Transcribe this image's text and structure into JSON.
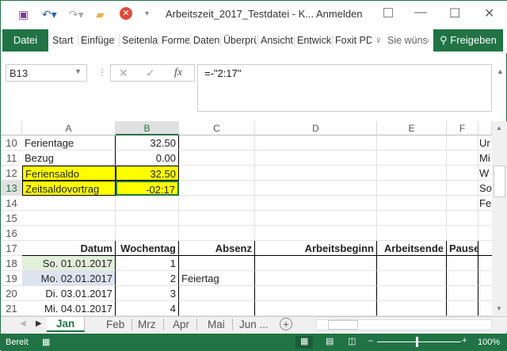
{
  "titlebar": {
    "title": "Arbeitszeit_2017_Testdatei - K...",
    "sign_in": "Anmelden",
    "icons": [
      "save-icon",
      "undo-icon",
      "redo-icon",
      "open-icon",
      "close-red-icon"
    ]
  },
  "ribbon": {
    "file": "Datei",
    "tabs": [
      "Start",
      "Einfüge",
      "Seitenla",
      "Formeln",
      "Daten",
      "Überprü",
      "Ansicht",
      "Entwick",
      "Foxit PD"
    ],
    "tell_me": "Sie wünsc",
    "share": "Freigeben"
  },
  "formula_bar": {
    "name_box": "B13",
    "formula": "=-\"2:17\""
  },
  "columns": [
    "A",
    "B",
    "C",
    "D",
    "E",
    "F"
  ],
  "rows": [
    {
      "n": "10",
      "a": "Ferientage",
      "b": "32.50",
      "g": "Ur"
    },
    {
      "n": "11",
      "a": "Bezug",
      "b": "0.00",
      "g": "Mi"
    },
    {
      "n": "12",
      "a": "Feriensaldo",
      "b": "32.50",
      "g": "W"
    },
    {
      "n": "13",
      "a": "Zeitsaldovortrag",
      "b": "-02:17",
      "g": "So"
    },
    {
      "n": "14",
      "g": "Fe"
    },
    {
      "n": "15"
    },
    {
      "n": "16"
    },
    {
      "n": "17",
      "a": "Datum",
      "b": "Wochentag",
      "c": "Absenz",
      "d": "Arbeitsbeginn",
      "e": "Arbeitsende",
      "f": "Pause"
    },
    {
      "n": "18",
      "a": "So. 01.01.2017",
      "b": "1"
    },
    {
      "n": "19",
      "a": "Mo. 02.01.2017",
      "b": "2",
      "c": "Feiertag"
    },
    {
      "n": "20",
      "a": "Di. 03.01.2017",
      "b": "3"
    },
    {
      "n": "21",
      "a": "Mi. 04.01.2017",
      "b": "4"
    }
  ],
  "sheets": [
    "Jan",
    "Feb",
    "Mrz",
    "Apr",
    "Mai",
    "Jun ..."
  ],
  "active_sheet": "Jan",
  "status": {
    "ready": "Bereit",
    "zoom": "100%"
  }
}
